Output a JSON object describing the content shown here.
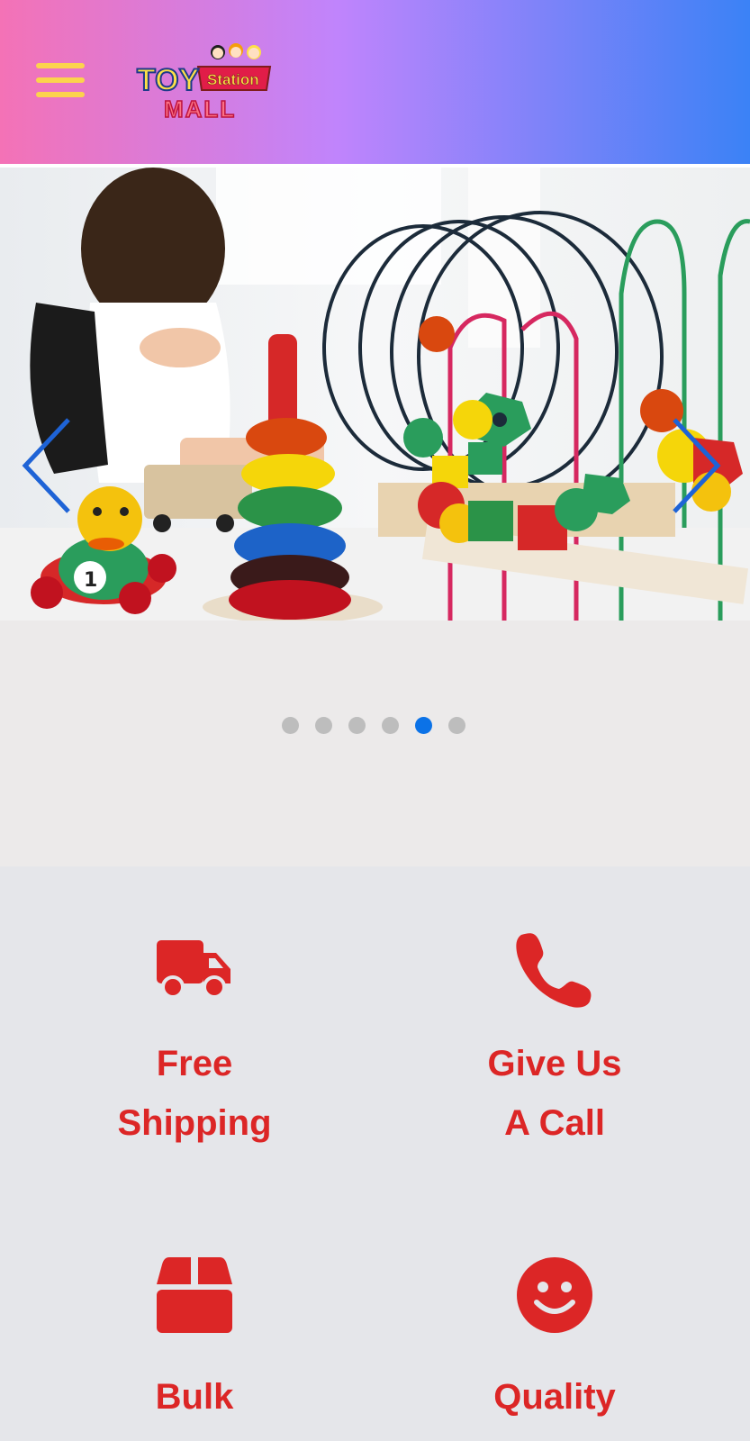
{
  "header": {
    "menu_icon": "hamburger-menu-icon",
    "logo": {
      "line1": "TOY",
      "line2": "Station",
      "line3": "MALL"
    },
    "gradient": [
      "#f472b6",
      "#c084fc",
      "#3b82f6"
    ]
  },
  "carousel": {
    "slide_count": 6,
    "active_index": 4,
    "prev_icon": "chevron-left-icon",
    "next_icon": "chevron-right-icon",
    "active_dot_color": "#0b72e7",
    "inactive_dot_color": "#bdbdbd"
  },
  "features": [
    {
      "icon": "truck-icon",
      "line1": "Free",
      "line2": "Shipping"
    },
    {
      "icon": "phone-icon",
      "line1": "Give Us",
      "line2": "A Call"
    },
    {
      "icon": "box-icon",
      "line1": "Bulk",
      "line2": ""
    },
    {
      "icon": "smile-icon",
      "line1": "Quality",
      "line2": ""
    }
  ],
  "accent_color": "#dc2626"
}
